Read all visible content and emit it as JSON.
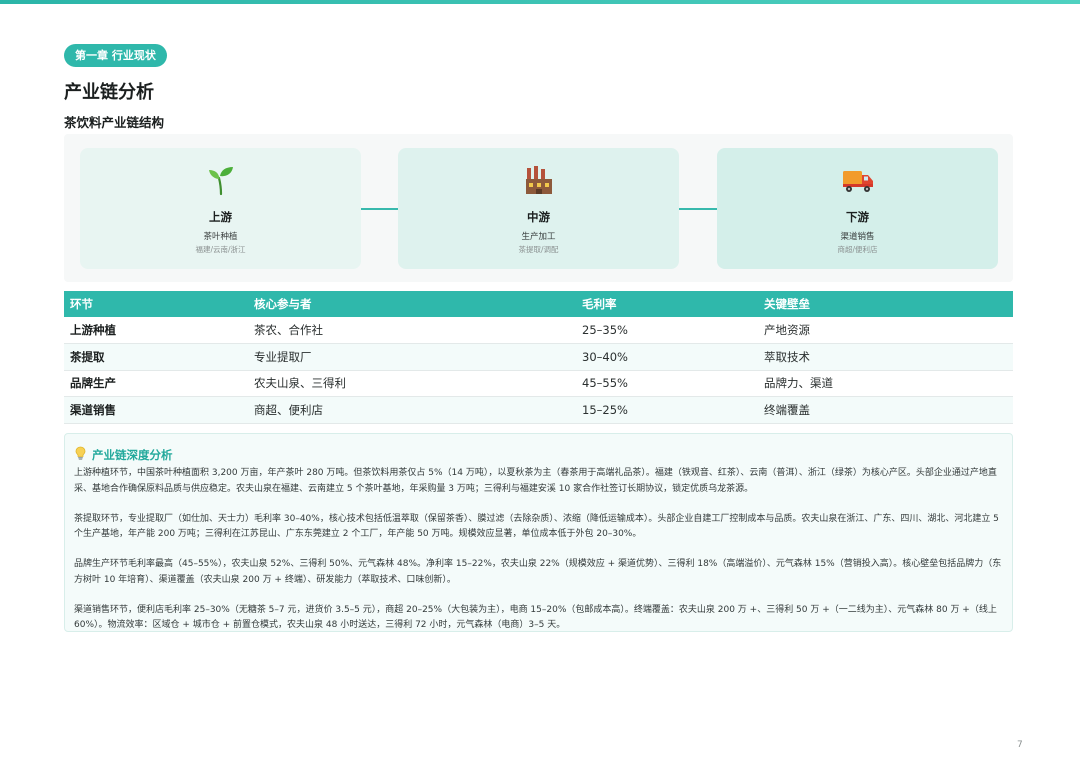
{
  "chapter_label": "第一章 行业现状",
  "page_title": "产业链分析",
  "section_subtitle": "茶饮料产业链结构",
  "chain": [
    {
      "icon": "seedling-icon",
      "title": "上游",
      "desc": "茶叶种植",
      "note": "福建/云南/浙江"
    },
    {
      "icon": "factory-icon",
      "title": "中游",
      "desc": "生产加工",
      "note": "茶提取/调配"
    },
    {
      "icon": "delivery-truck-icon",
      "title": "下游",
      "desc": "渠道销售",
      "note": "商超/便利店"
    }
  ],
  "table": {
    "headers": [
      "环节",
      "核心参与者",
      "毛利率",
      "关键壁垒"
    ],
    "rows": [
      [
        "上游种植",
        "茶农、合作社",
        "25–35%",
        "产地资源"
      ],
      [
        "茶提取",
        "专业提取厂",
        "30–40%",
        "萃取技术"
      ],
      [
        "品牌生产",
        "农夫山泉、三得利",
        "45–55%",
        "品牌力、渠道"
      ],
      [
        "渠道销售",
        "商超、便利店",
        "15–25%",
        "终端覆盖"
      ]
    ]
  },
  "analysis": {
    "icon": "lightbulb-icon",
    "title": "产业链深度分析",
    "paragraphs": [
      "上游种植环节，中国茶叶种植面积 3,200 万亩，年产茶叶 280 万吨。但茶饮料用茶仅占 5%（14 万吨），以夏秋茶为主（春茶用于高端礼品茶）。福建（铁观音、红茶）、云南（普洱）、浙江（绿茶）为核心产区。头部企业通过产地直采、基地合作确保原料品质与供应稳定。农夫山泉在福建、云南建立 5 个茶叶基地，年采购量 3 万吨；三得利与福建安溪 10 家合作社签订长期协议，锁定优质乌龙茶源。",
      "茶提取环节，专业提取厂（如仕加、天士力）毛利率 30–40%，核心技术包括低温萃取（保留茶香）、膜过滤（去除杂质）、浓缩（降低运输成本）。头部企业自建工厂控制成本与品质。农夫山泉在浙江、广东、四川、湖北、河北建立 5 个生产基地，年产能 200 万吨；三得利在江苏昆山、广东东莞建立 2 个工厂，年产能 50 万吨。规模效应显著，单位成本低于外包 20–30%。",
      "品牌生产环节毛利率最高（45–55%），农夫山泉 52%、三得利 50%、元气森林 48%。净利率 15–22%，农夫山泉 22%（规模效应 + 渠道优势）、三得利 18%（高端溢价）、元气森林 15%（营销投入高）。核心壁垒包括品牌力（东方树叶 10 年培育）、渠道覆盖（农夫山泉 200 万 + 终端）、研发能力（萃取技术、口味创新）。",
      "渠道销售环节，便利店毛利率 25–30%（无糖茶 5–7 元，进货价 3.5–5 元），商超 20–25%（大包装为主），电商 15–20%（包邮成本高）。终端覆盖：农夫山泉 200 万 +、三得利 50 万 +（一二线为主）、元气森林 80 万 +（线上 60%）。物流效率：区域仓 + 城市仓 + 前置仓模式，农夫山泉 48 小时送达，三得利 72 小时，元气森林（电商）3–5 天。"
    ]
  },
  "page_number": "7",
  "colors": {
    "accent": "#2fb8ab",
    "accent_text": "#23a99c",
    "card_bg": "#e3f4f1"
  }
}
